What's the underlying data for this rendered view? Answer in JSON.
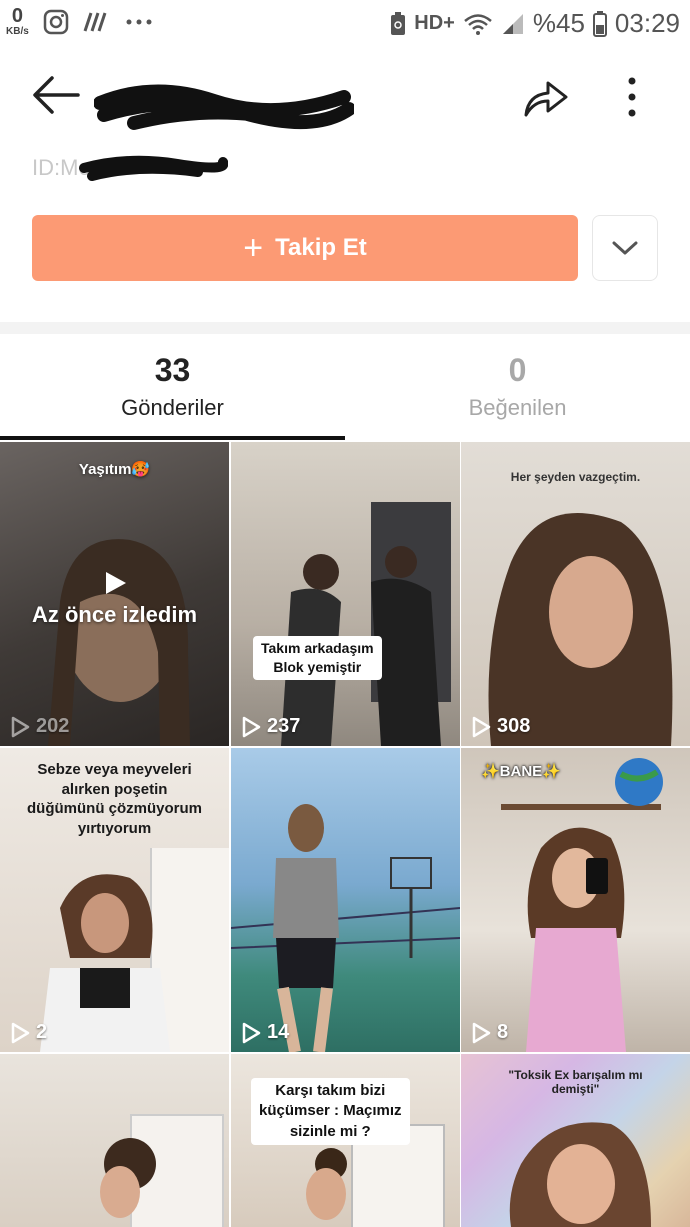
{
  "status_bar": {
    "net_speed_value": "0",
    "net_speed_unit": "KB/s",
    "network": "HD+",
    "battery_percent": "%45",
    "time": "03:29"
  },
  "profile": {
    "id_label": "ID:Me",
    "follow_label": "Takip Et"
  },
  "tabs": [
    {
      "count": "33",
      "label": "Gönderiler"
    },
    {
      "count": "0",
      "label": "Beğenilen"
    }
  ],
  "videos": [
    {
      "caption": "Yaşıtım🥵",
      "overlay": "Az önce izledim",
      "views": "202"
    },
    {
      "caption": "Takım arkadaşım\nBlok yemiştir",
      "views": "237"
    },
    {
      "caption": "Her şeyden vazgeçtim.",
      "views": "308"
    },
    {
      "caption": "Sebze veya meyveleri\nalırken poşetin\ndüğümünü çözmüyorum\nyırtıyorum",
      "views": "2"
    },
    {
      "caption": "",
      "views": "14"
    },
    {
      "caption": "✨BANE✨",
      "views": "8"
    },
    {
      "caption": "",
      "views": ""
    },
    {
      "caption": "Karşı takım bizi\nküçümser : Maçımız\nsizinle mi ?",
      "views": ""
    },
    {
      "caption": "\"Toksik Ex barışalım mı\ndemişti\"",
      "views": ""
    }
  ],
  "colors": {
    "follow_button": "#fc9a74",
    "active_tab": "#222222",
    "inactive_tab": "#a8a8a8"
  }
}
